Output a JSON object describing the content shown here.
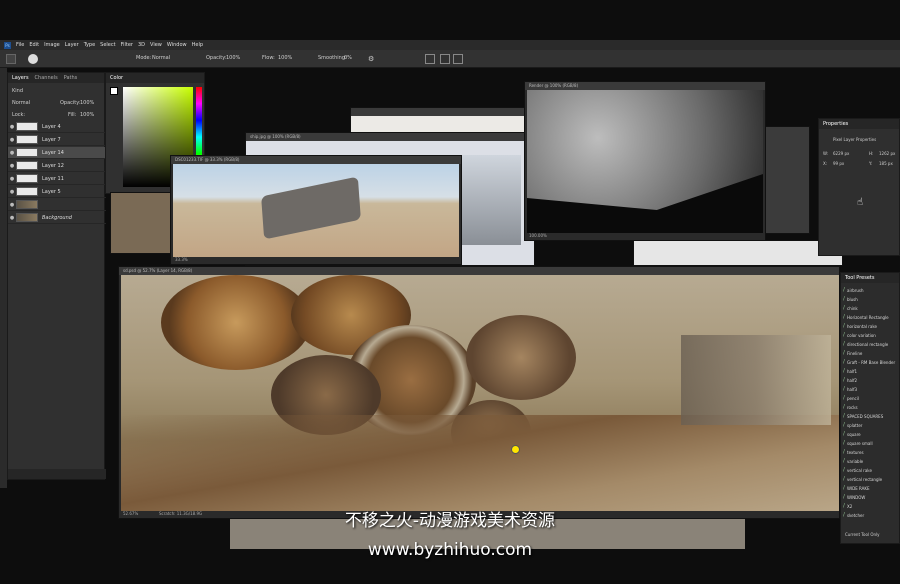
{
  "menu": [
    "File",
    "Edit",
    "Image",
    "Layer",
    "Type",
    "Select",
    "Filter",
    "3D",
    "View",
    "Window",
    "Help"
  ],
  "options_bar": {
    "mode_label": "Mode:",
    "mode_value": "Normal",
    "opacity_label": "Opacity:",
    "opacity_value": "100%",
    "flow_label": "Flow:",
    "flow_value": "100%",
    "smoothing_label": "Smoothing:",
    "smoothing_value": "0%"
  },
  "layers_panel": {
    "tabs": [
      "Layers",
      "Channels",
      "Paths"
    ],
    "filter_kind": "Kind",
    "blend_mode": "Normal",
    "opacity_label": "Opacity:",
    "opacity_value": "100%",
    "lock_label": "Lock:",
    "fill_label": "Fill:",
    "fill_value": "100%",
    "layers": [
      {
        "name": "Layer 4",
        "thumb": "light"
      },
      {
        "name": "Layer 7",
        "thumb": "light"
      },
      {
        "name": "Layer 14",
        "thumb": "light",
        "selected": true
      },
      {
        "name": "Layer 12",
        "thumb": "light"
      },
      {
        "name": "Layer 11",
        "thumb": "light"
      },
      {
        "name": "Layer 5",
        "thumb": "light"
      },
      {
        "name": "",
        "thumb": "dark"
      },
      {
        "name": "Background",
        "thumb": "dark"
      }
    ]
  },
  "color_panel": {
    "title": "Color"
  },
  "docs": {
    "desert_photo": {
      "title": "DSC01233.TIF @ 33.3% (RGB/8)",
      "zoom": "33.3%"
    },
    "ship_photo": {
      "title": "ship.jpg @ 100% (RGB/8)"
    },
    "render": {
      "title": "Render @ 100% (RGB/8)",
      "zoom": "100.00%"
    },
    "main": {
      "title": "sd.psd @ 52.7% (Layer 14, RGB/8)",
      "zoom": "52.67%",
      "status": "Scratch: 11.3G/18.9G"
    }
  },
  "properties": {
    "title": "Properties",
    "subtitle": "Pixel Layer Properties",
    "w_label": "W:",
    "w_value": "6229 px",
    "h_label": "H:",
    "h_value": "1262 px",
    "x_label": "X:",
    "x_value": "99 px",
    "y_label": "Y:",
    "y_value": "185 px"
  },
  "tool_presets": {
    "title": "Tool Presets",
    "items": [
      "airbrush",
      "blush",
      "chink",
      "Horizontal Rectangle",
      "horizontal rake",
      "color variation",
      "directional rectangle",
      "Fineline",
      "Graft - RM Base Blender",
      "half1",
      "half2",
      "half3",
      "pencil",
      "rocks",
      "SPACED SQUARES",
      "splatter",
      "square",
      "square small",
      "textures",
      "variable",
      "vertical rake",
      "vertical rectangle",
      "WIDE RAKE",
      "WINDOW",
      "X2",
      "sketcher"
    ],
    "footer": "Current Tool Only"
  },
  "watermark": {
    "line1": "不移之火-动漫游戏美术资源",
    "line2": "www.byzhihuo.com"
  }
}
